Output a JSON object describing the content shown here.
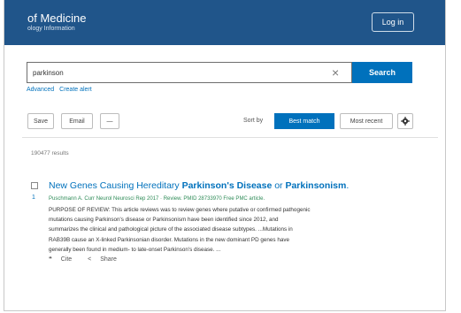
{
  "header": {
    "brand_title": "of Medicine",
    "brand_subtitle": "ology Information",
    "login_label": "Log in",
    "color": "#20558a"
  },
  "search": {
    "query": "parkinson",
    "clear_icon": "close-icon",
    "button_label": "Search",
    "advanced_label": "Advanced",
    "create_alert_label": "Create alert"
  },
  "toolbar": {
    "save_label": "Save",
    "email_label": "Email",
    "more_label": "—",
    "sort_by_label": "Sort by",
    "best_match_label": "Best match",
    "most_recent_label": "Most recent",
    "settings_icon": "gear-icon"
  },
  "results": {
    "count_text": "190477 results",
    "items": [
      {
        "number": "1",
        "title_plain_1": "New Genes Causing Hereditary ",
        "title_bold_1": "Parkinson's Disease",
        "title_plain_2": " or ",
        "title_bold_2": "Parkinsonism",
        "title_end": ".",
        "citation": "Puschmann A. Curr Neurol Neurosci Rep 2017 · Review. PMID 28733970 Free PMC article.",
        "snippet_lines": [
          "PURPOSE OF REVIEW: This article reviews was to review genes where putative or confirmed pathogenic",
          "mutations causing Parkinson's disease or Parkinsonism have been identified since 2012, and",
          "summarizes the clinical and pathological picture of the associated disease subtypes. ...Mutations in",
          "RAB39B cause an X-linked Parkinsonian disorder. Mutations in the new dominant PD genes have",
          "generally been found in medium- to late-onset Parkinson's disease. ..."
        ],
        "cite_label": "Cite",
        "share_label": "Share"
      }
    ]
  },
  "colors": {
    "accent": "#0071bc",
    "citation": "#2e8b57"
  }
}
